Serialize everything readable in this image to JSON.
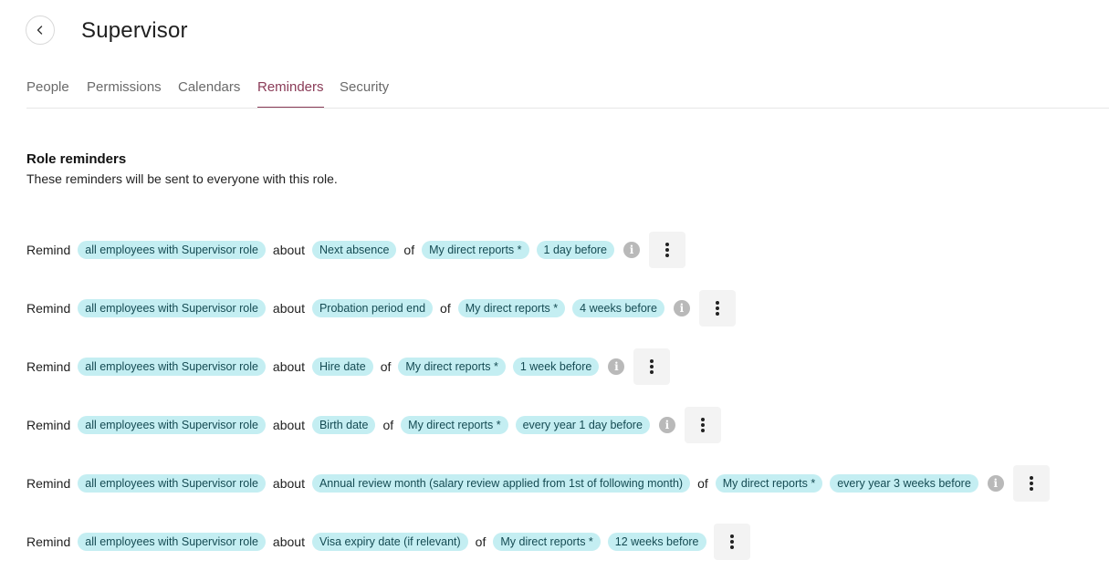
{
  "header": {
    "title": "Supervisor"
  },
  "tabs": [
    {
      "label": "People"
    },
    {
      "label": "Permissions"
    },
    {
      "label": "Calendars"
    },
    {
      "label": "Reminders",
      "active": true
    },
    {
      "label": "Security"
    }
  ],
  "section": {
    "title": "Role reminders",
    "description": "These reminders will be sent to everyone with this role."
  },
  "words": {
    "remind": "Remind",
    "about": "about",
    "of": "of"
  },
  "reminders": [
    {
      "recipient": "all employees with Supervisor role",
      "event": "Next absence",
      "subject": "My direct reports *",
      "timing": "1 day before",
      "has_info": true
    },
    {
      "recipient": "all employees with Supervisor role",
      "event": "Probation period end",
      "subject": "My direct reports *",
      "timing": "4 weeks before",
      "has_info": true
    },
    {
      "recipient": "all employees with Supervisor role",
      "event": "Hire date",
      "subject": "My direct reports *",
      "timing": "1 week before",
      "has_info": true
    },
    {
      "recipient": "all employees with Supervisor role",
      "event": "Birth date",
      "subject": "My direct reports *",
      "timing": "every year 1 day before",
      "has_info": true
    },
    {
      "recipient": "all employees with Supervisor role",
      "event": "Annual review month (salary review applied from 1st of following month)",
      "subject": "My direct reports *",
      "timing": "every year 3 weeks before",
      "has_info": true
    },
    {
      "recipient": "all employees with Supervisor role",
      "event": "Visa expiry date (if relevant)",
      "subject": "My direct reports *",
      "timing": "12 weeks before",
      "has_info": false
    }
  ],
  "icons": {
    "back": "chevron-left-icon",
    "info": "info-icon",
    "menu": "more-vertical-icon"
  },
  "colors": {
    "accent": "#8a3b57",
    "pill_bg": "#c4eef2",
    "pill_text": "#154b53"
  }
}
